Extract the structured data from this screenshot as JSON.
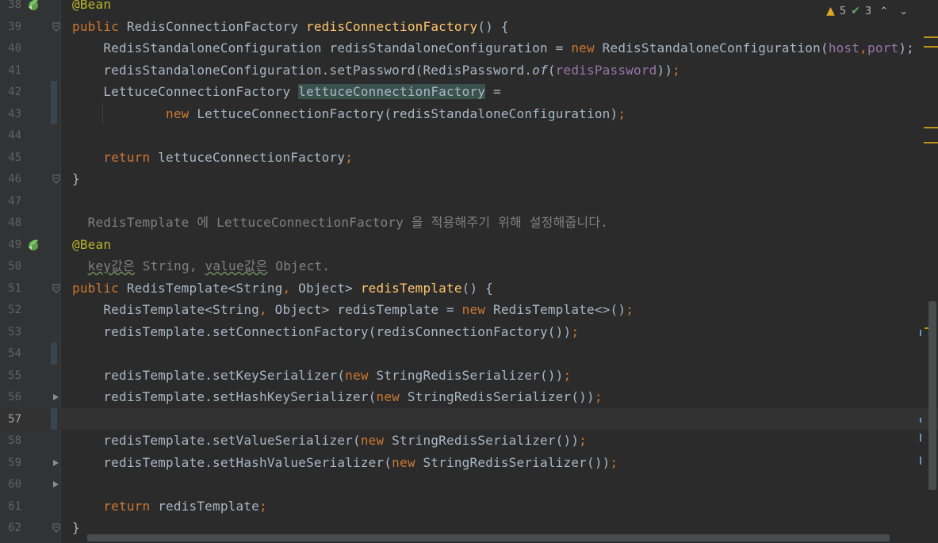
{
  "inspection": {
    "warnings": "5",
    "weak_warnings": "3",
    "warn_icon": "warning-triangle-icon",
    "check_icon": "double-check-icon"
  },
  "colors": {
    "keyword": "#cc7832",
    "annotation": "#bbb529",
    "method_decl": "#ffc66d",
    "field": "#9876aa",
    "comment": "#808080",
    "text": "#a9b7c6",
    "background": "#2b2b2b",
    "gutter": "#313335"
  },
  "lines": [
    {
      "n": "38",
      "seg": [
        [
          "@Bean",
          "ann"
        ]
      ],
      "icon": "bean-icon"
    },
    {
      "n": "39",
      "seg": [
        [
          "public ",
          "kw"
        ],
        [
          "RedisConnectionFactory ",
          ""
        ],
        [
          "redisConnectionFactory",
          "fn"
        ],
        [
          "() {",
          ""
        ]
      ],
      "fold": true
    },
    {
      "n": "40",
      "seg": [
        [
          "    RedisStandaloneConfiguration redisStandaloneConfiguration = ",
          ""
        ],
        [
          "new ",
          "kw"
        ],
        [
          "RedisStandaloneConfiguration(",
          ""
        ],
        [
          "host",
          "fld"
        ],
        [
          ",",
          "kw"
        ],
        [
          "port",
          "fld"
        ],
        [
          ");",
          ""
        ]
      ]
    },
    {
      "n": "41",
      "seg": [
        [
          "    redisStandaloneConfiguration.setPassword(RedisPassword.",
          ""
        ],
        [
          "of",
          "it"
        ],
        [
          "(",
          ""
        ],
        [
          "redisPassword",
          "fld"
        ],
        [
          "))",
          ""
        ],
        [
          ";",
          "kw"
        ]
      ]
    },
    {
      "n": "42",
      "seg": [
        [
          "    LettuceConnectionFactory ",
          ""
        ],
        [
          "lettuceConnectionFactory",
          "hlvar"
        ],
        [
          " =",
          ""
        ]
      ],
      "change": true
    },
    {
      "n": "43",
      "seg": [
        [
          "            ",
          ""
        ],
        [
          "new ",
          "kw"
        ],
        [
          "LettuceConnectionFactory(redisStandaloneConfiguration)",
          ""
        ],
        [
          ";",
          "kw"
        ]
      ],
      "change": true,
      "guide": true
    },
    {
      "n": "44",
      "seg": []
    },
    {
      "n": "45",
      "seg": [
        [
          "    ",
          ""
        ],
        [
          "return ",
          "kw"
        ],
        [
          "lettuceConnectionFactory",
          ""
        ],
        [
          ";",
          "kw"
        ]
      ]
    },
    {
      "n": "46",
      "seg": [
        [
          "}",
          ""
        ]
      ],
      "fold": true
    },
    {
      "n": "47",
      "seg": []
    },
    {
      "n": "48",
      "seg": [
        [
          "  RedisTemplate 에 LettuceConnectionFactory 을 적용해주기 위해 설정해줍니다.",
          "cm"
        ]
      ]
    },
    {
      "n": "49",
      "seg": [
        [
          "@Bean",
          "ann"
        ]
      ],
      "icon": "bean-icon"
    },
    {
      "n": "50",
      "seg": [
        [
          "  ",
          ""
        ],
        [
          "key값은",
          "cm ul"
        ],
        [
          " String, ",
          "cm"
        ],
        [
          "value값은",
          "cm ul"
        ],
        [
          " Object.",
          "cm"
        ]
      ]
    },
    {
      "n": "51",
      "seg": [
        [
          "public ",
          "kw"
        ],
        [
          "RedisTemplate<String",
          ""
        ],
        [
          ", ",
          "kw"
        ],
        [
          "Object> ",
          ""
        ],
        [
          "redisTemplate",
          "fn"
        ],
        [
          "() {",
          ""
        ]
      ],
      "fold": true
    },
    {
      "n": "52",
      "seg": [
        [
          "    RedisTemplate<String",
          ""
        ],
        [
          ", ",
          "kw"
        ],
        [
          "Object> redisTemplate = ",
          ""
        ],
        [
          "new ",
          "kw"
        ],
        [
          "RedisTemplate<>()",
          ""
        ],
        [
          ";",
          "kw"
        ]
      ]
    },
    {
      "n": "53",
      "seg": [
        [
          "    redisTemplate.setConnectionFactory(redisConnectionFactory())",
          ""
        ],
        [
          ";",
          "kw"
        ]
      ]
    },
    {
      "n": "54",
      "seg": [],
      "change": true
    },
    {
      "n": "55",
      "seg": [
        [
          "    redisTemplate.setKeySerializer(",
          ""
        ],
        [
          "new ",
          "kw"
        ],
        [
          "StringRedisSerializer())",
          ""
        ],
        [
          ";",
          "kw"
        ]
      ]
    },
    {
      "n": "56",
      "seg": [
        [
          "    redisTemplate.setHashKeySerializer(",
          ""
        ],
        [
          "new ",
          "kw"
        ],
        [
          "StringRedisSerializer())",
          ""
        ],
        [
          ";",
          "kw"
        ]
      ],
      "arrow": true
    },
    {
      "n": "57",
      "seg": [],
      "current": true,
      "change": true
    },
    {
      "n": "58",
      "seg": [
        [
          "    redisTemplate.setValueSerializer(",
          ""
        ],
        [
          "new ",
          "kw"
        ],
        [
          "StringRedisSerializer())",
          ""
        ],
        [
          ";",
          "kw"
        ]
      ]
    },
    {
      "n": "59",
      "seg": [
        [
          "    redisTemplate.setHashValueSerializer(",
          ""
        ],
        [
          "new ",
          "kw"
        ],
        [
          "StringRedisSerializer())",
          ""
        ],
        [
          ";",
          "kw"
        ]
      ],
      "arrow": true
    },
    {
      "n": "60",
      "seg": [],
      "arrow": true
    },
    {
      "n": "61",
      "seg": [
        [
          "    ",
          ""
        ],
        [
          "return ",
          "kw"
        ],
        [
          "redisTemplate",
          ""
        ],
        [
          ";",
          "kw"
        ]
      ]
    },
    {
      "n": "62",
      "seg": [
        [
          "}",
          ""
        ]
      ],
      "fold": true
    }
  ]
}
